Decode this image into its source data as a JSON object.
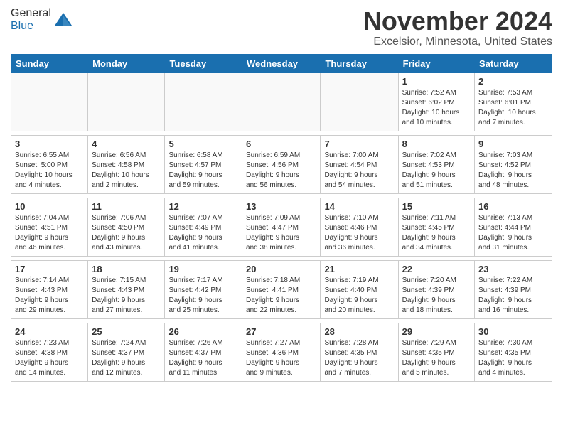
{
  "header": {
    "logo_general": "General",
    "logo_blue": "Blue",
    "month_title": "November 2024",
    "location": "Excelsior, Minnesota, United States"
  },
  "weekdays": [
    "Sunday",
    "Monday",
    "Tuesday",
    "Wednesday",
    "Thursday",
    "Friday",
    "Saturday"
  ],
  "weeks": [
    [
      {
        "day": "",
        "empty": true
      },
      {
        "day": "",
        "empty": true
      },
      {
        "day": "",
        "empty": true
      },
      {
        "day": "",
        "empty": true
      },
      {
        "day": "",
        "empty": true
      },
      {
        "day": "1",
        "sunrise": "Sunrise: 7:52 AM",
        "sunset": "Sunset: 6:02 PM",
        "daylight": "Daylight: 10 hours and 10 minutes."
      },
      {
        "day": "2",
        "sunrise": "Sunrise: 7:53 AM",
        "sunset": "Sunset: 6:01 PM",
        "daylight": "Daylight: 10 hours and 7 minutes."
      }
    ],
    [
      {
        "day": "3",
        "sunrise": "Sunrise: 6:55 AM",
        "sunset": "Sunset: 5:00 PM",
        "daylight": "Daylight: 10 hours and 4 minutes."
      },
      {
        "day": "4",
        "sunrise": "Sunrise: 6:56 AM",
        "sunset": "Sunset: 4:58 PM",
        "daylight": "Daylight: 10 hours and 2 minutes."
      },
      {
        "day": "5",
        "sunrise": "Sunrise: 6:58 AM",
        "sunset": "Sunset: 4:57 PM",
        "daylight": "Daylight: 9 hours and 59 minutes."
      },
      {
        "day": "6",
        "sunrise": "Sunrise: 6:59 AM",
        "sunset": "Sunset: 4:56 PM",
        "daylight": "Daylight: 9 hours and 56 minutes."
      },
      {
        "day": "7",
        "sunrise": "Sunrise: 7:00 AM",
        "sunset": "Sunset: 4:54 PM",
        "daylight": "Daylight: 9 hours and 54 minutes."
      },
      {
        "day": "8",
        "sunrise": "Sunrise: 7:02 AM",
        "sunset": "Sunset: 4:53 PM",
        "daylight": "Daylight: 9 hours and 51 minutes."
      },
      {
        "day": "9",
        "sunrise": "Sunrise: 7:03 AM",
        "sunset": "Sunset: 4:52 PM",
        "daylight": "Daylight: 9 hours and 48 minutes."
      }
    ],
    [
      {
        "day": "10",
        "sunrise": "Sunrise: 7:04 AM",
        "sunset": "Sunset: 4:51 PM",
        "daylight": "Daylight: 9 hours and 46 minutes."
      },
      {
        "day": "11",
        "sunrise": "Sunrise: 7:06 AM",
        "sunset": "Sunset: 4:50 PM",
        "daylight": "Daylight: 9 hours and 43 minutes."
      },
      {
        "day": "12",
        "sunrise": "Sunrise: 7:07 AM",
        "sunset": "Sunset: 4:49 PM",
        "daylight": "Daylight: 9 hours and 41 minutes."
      },
      {
        "day": "13",
        "sunrise": "Sunrise: 7:09 AM",
        "sunset": "Sunset: 4:47 PM",
        "daylight": "Daylight: 9 hours and 38 minutes."
      },
      {
        "day": "14",
        "sunrise": "Sunrise: 7:10 AM",
        "sunset": "Sunset: 4:46 PM",
        "daylight": "Daylight: 9 hours and 36 minutes."
      },
      {
        "day": "15",
        "sunrise": "Sunrise: 7:11 AM",
        "sunset": "Sunset: 4:45 PM",
        "daylight": "Daylight: 9 hours and 34 minutes."
      },
      {
        "day": "16",
        "sunrise": "Sunrise: 7:13 AM",
        "sunset": "Sunset: 4:44 PM",
        "daylight": "Daylight: 9 hours and 31 minutes."
      }
    ],
    [
      {
        "day": "17",
        "sunrise": "Sunrise: 7:14 AM",
        "sunset": "Sunset: 4:43 PM",
        "daylight": "Daylight: 9 hours and 29 minutes."
      },
      {
        "day": "18",
        "sunrise": "Sunrise: 7:15 AM",
        "sunset": "Sunset: 4:43 PM",
        "daylight": "Daylight: 9 hours and 27 minutes."
      },
      {
        "day": "19",
        "sunrise": "Sunrise: 7:17 AM",
        "sunset": "Sunset: 4:42 PM",
        "daylight": "Daylight: 9 hours and 25 minutes."
      },
      {
        "day": "20",
        "sunrise": "Sunrise: 7:18 AM",
        "sunset": "Sunset: 4:41 PM",
        "daylight": "Daylight: 9 hours and 22 minutes."
      },
      {
        "day": "21",
        "sunrise": "Sunrise: 7:19 AM",
        "sunset": "Sunset: 4:40 PM",
        "daylight": "Daylight: 9 hours and 20 minutes."
      },
      {
        "day": "22",
        "sunrise": "Sunrise: 7:20 AM",
        "sunset": "Sunset: 4:39 PM",
        "daylight": "Daylight: 9 hours and 18 minutes."
      },
      {
        "day": "23",
        "sunrise": "Sunrise: 7:22 AM",
        "sunset": "Sunset: 4:39 PM",
        "daylight": "Daylight: 9 hours and 16 minutes."
      }
    ],
    [
      {
        "day": "24",
        "sunrise": "Sunrise: 7:23 AM",
        "sunset": "Sunset: 4:38 PM",
        "daylight": "Daylight: 9 hours and 14 minutes."
      },
      {
        "day": "25",
        "sunrise": "Sunrise: 7:24 AM",
        "sunset": "Sunset: 4:37 PM",
        "daylight": "Daylight: 9 hours and 12 minutes."
      },
      {
        "day": "26",
        "sunrise": "Sunrise: 7:26 AM",
        "sunset": "Sunset: 4:37 PM",
        "daylight": "Daylight: 9 hours and 11 minutes."
      },
      {
        "day": "27",
        "sunrise": "Sunrise: 7:27 AM",
        "sunset": "Sunset: 4:36 PM",
        "daylight": "Daylight: 9 hours and 9 minutes."
      },
      {
        "day": "28",
        "sunrise": "Sunrise: 7:28 AM",
        "sunset": "Sunset: 4:35 PM",
        "daylight": "Daylight: 9 hours and 7 minutes."
      },
      {
        "day": "29",
        "sunrise": "Sunrise: 7:29 AM",
        "sunset": "Sunset: 4:35 PM",
        "daylight": "Daylight: 9 hours and 5 minutes."
      },
      {
        "day": "30",
        "sunrise": "Sunrise: 7:30 AM",
        "sunset": "Sunset: 4:35 PM",
        "daylight": "Daylight: 9 hours and 4 minutes."
      }
    ]
  ]
}
